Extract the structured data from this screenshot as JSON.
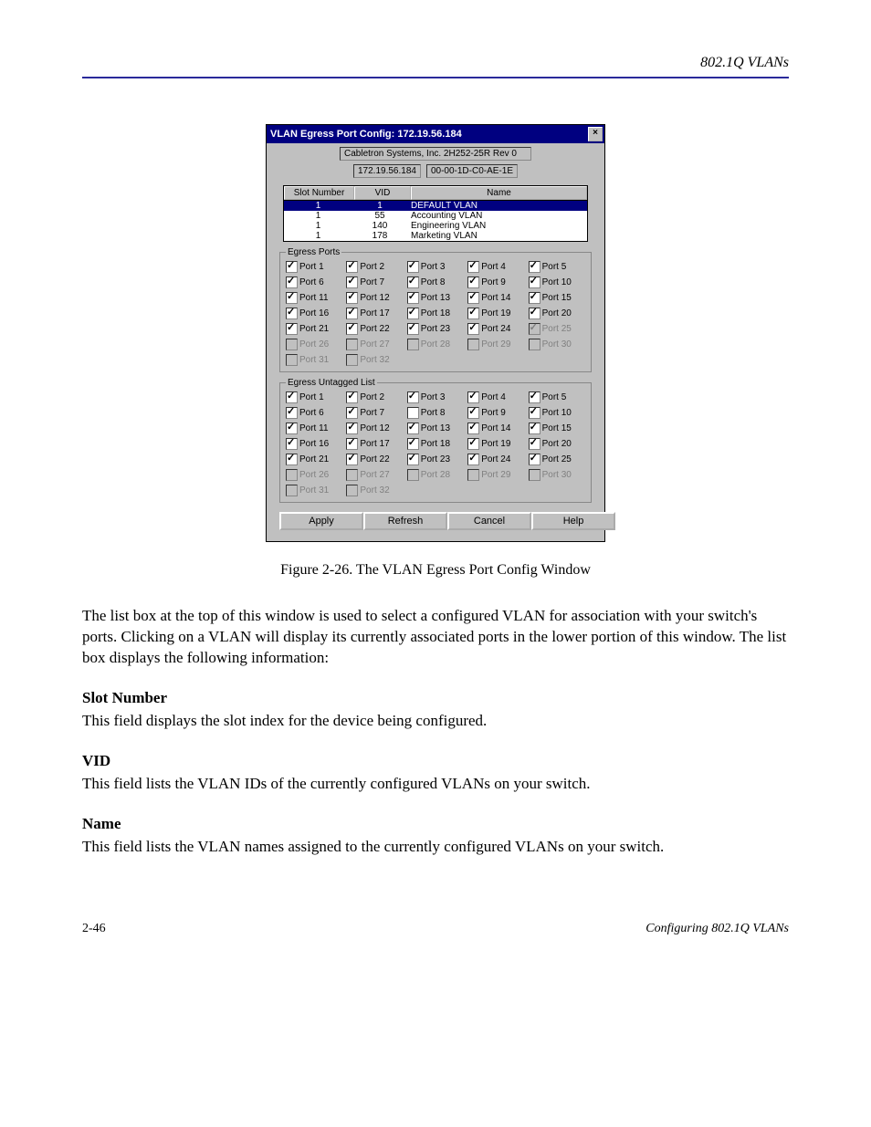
{
  "header": {
    "section": "802.1Q VLANs"
  },
  "dialog": {
    "title": "VLAN Egress Port Config: 172.19.56.184",
    "vendor": "Cabletron Systems, Inc. 2H252-25R Rev 0",
    "ip": "172.19.56.184",
    "mac": "00-00-1D-C0-AE-1E",
    "columns": {
      "slot": "Slot Number",
      "vid": "VID",
      "name": "Name"
    },
    "rows": [
      {
        "slot": "1",
        "vid": "1",
        "name": "DEFAULT VLAN",
        "selected": true
      },
      {
        "slot": "1",
        "vid": "55",
        "name": "Accounting VLAN",
        "selected": false
      },
      {
        "slot": "1",
        "vid": "140",
        "name": "Engineering VLAN",
        "selected": false
      },
      {
        "slot": "1",
        "vid": "178",
        "name": "Marketing VLAN",
        "selected": false
      }
    ],
    "egress_legend": "Egress Ports",
    "untagged_legend": "Egress Untagged List",
    "egress_ports": [
      {
        "n": 1,
        "c": true,
        "d": false
      },
      {
        "n": 2,
        "c": true,
        "d": false
      },
      {
        "n": 3,
        "c": true,
        "d": false
      },
      {
        "n": 4,
        "c": true,
        "d": false
      },
      {
        "n": 5,
        "c": true,
        "d": false
      },
      {
        "n": 6,
        "c": true,
        "d": false
      },
      {
        "n": 7,
        "c": true,
        "d": false
      },
      {
        "n": 8,
        "c": true,
        "d": false
      },
      {
        "n": 9,
        "c": true,
        "d": false
      },
      {
        "n": 10,
        "c": true,
        "d": false
      },
      {
        "n": 11,
        "c": true,
        "d": false
      },
      {
        "n": 12,
        "c": true,
        "d": false
      },
      {
        "n": 13,
        "c": true,
        "d": false
      },
      {
        "n": 14,
        "c": true,
        "d": false
      },
      {
        "n": 15,
        "c": true,
        "d": false
      },
      {
        "n": 16,
        "c": true,
        "d": false
      },
      {
        "n": 17,
        "c": true,
        "d": false
      },
      {
        "n": 18,
        "c": true,
        "d": false
      },
      {
        "n": 19,
        "c": true,
        "d": false
      },
      {
        "n": 20,
        "c": true,
        "d": false
      },
      {
        "n": 21,
        "c": true,
        "d": false
      },
      {
        "n": 22,
        "c": true,
        "d": false
      },
      {
        "n": 23,
        "c": true,
        "d": false
      },
      {
        "n": 24,
        "c": true,
        "d": false
      },
      {
        "n": 25,
        "c": true,
        "d": true
      },
      {
        "n": 26,
        "c": false,
        "d": true
      },
      {
        "n": 27,
        "c": false,
        "d": true
      },
      {
        "n": 28,
        "c": false,
        "d": true
      },
      {
        "n": 29,
        "c": false,
        "d": true
      },
      {
        "n": 30,
        "c": false,
        "d": true
      },
      {
        "n": 31,
        "c": false,
        "d": true
      },
      {
        "n": 32,
        "c": false,
        "d": true
      }
    ],
    "untagged_ports": [
      {
        "n": 1,
        "c": true,
        "d": false
      },
      {
        "n": 2,
        "c": true,
        "d": false
      },
      {
        "n": 3,
        "c": true,
        "d": false
      },
      {
        "n": 4,
        "c": true,
        "d": false
      },
      {
        "n": 5,
        "c": true,
        "d": false
      },
      {
        "n": 6,
        "c": true,
        "d": false
      },
      {
        "n": 7,
        "c": true,
        "d": false
      },
      {
        "n": 8,
        "c": false,
        "d": false
      },
      {
        "n": 9,
        "c": true,
        "d": false
      },
      {
        "n": 10,
        "c": true,
        "d": false
      },
      {
        "n": 11,
        "c": true,
        "d": false
      },
      {
        "n": 12,
        "c": true,
        "d": false
      },
      {
        "n": 13,
        "c": true,
        "d": false
      },
      {
        "n": 14,
        "c": true,
        "d": false
      },
      {
        "n": 15,
        "c": true,
        "d": false
      },
      {
        "n": 16,
        "c": true,
        "d": false
      },
      {
        "n": 17,
        "c": true,
        "d": false
      },
      {
        "n": 18,
        "c": true,
        "d": false
      },
      {
        "n": 19,
        "c": true,
        "d": false
      },
      {
        "n": 20,
        "c": true,
        "d": false
      },
      {
        "n": 21,
        "c": true,
        "d": false
      },
      {
        "n": 22,
        "c": true,
        "d": false
      },
      {
        "n": 23,
        "c": true,
        "d": false
      },
      {
        "n": 24,
        "c": true,
        "d": false
      },
      {
        "n": 25,
        "c": true,
        "d": false
      },
      {
        "n": 26,
        "c": false,
        "d": true
      },
      {
        "n": 27,
        "c": false,
        "d": true
      },
      {
        "n": 28,
        "c": false,
        "d": true
      },
      {
        "n": 29,
        "c": false,
        "d": true
      },
      {
        "n": 30,
        "c": false,
        "d": true
      },
      {
        "n": 31,
        "c": false,
        "d": true
      },
      {
        "n": 32,
        "c": false,
        "d": true
      }
    ],
    "buttons": {
      "apply": "Apply",
      "refresh": "Refresh",
      "cancel": "Cancel",
      "help": "Help"
    }
  },
  "caption": "Figure 2-26. The VLAN Egress Port Config Window",
  "body": {
    "intro": "The list box at the top of this window is used to select a configured VLAN for association with your switch's ports. Clicking on a VLAN will display its currently associated ports in the lower portion of this window. The list box displays the following information:",
    "slot_head": "Slot Number",
    "slot_body": "This field displays the slot index for the device being configured.",
    "vid_head": "VID",
    "vid_body": "This field lists the VLAN IDs of the currently configured VLANs on your switch.",
    "name_head": "Name",
    "name_body": "This field lists the VLAN names assigned to the currently configured VLANs on your switch."
  },
  "footer": {
    "page": "2-46",
    "title": "Configuring 802.1Q VLANs"
  },
  "port_prefix": "Port "
}
